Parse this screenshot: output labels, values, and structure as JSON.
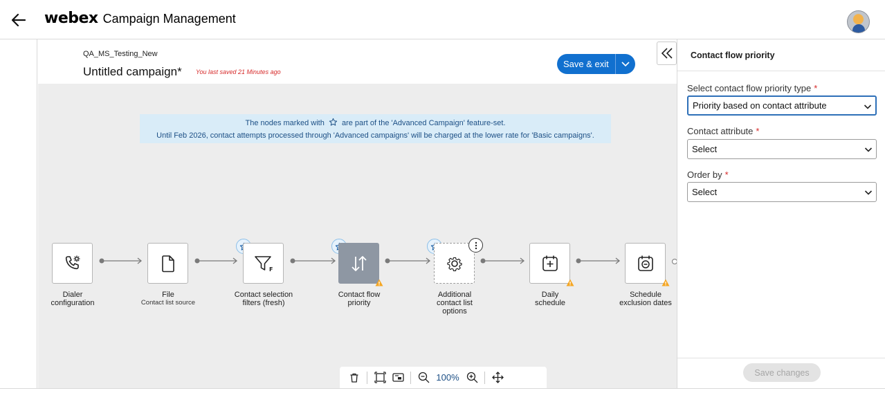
{
  "header": {
    "brand_logo": "webex",
    "app_title": "Campaign Management"
  },
  "campaign": {
    "subtitle": "QA_MS_Testing_New",
    "title": "Untitled campaign*",
    "saved_note": "You last saved 21 Minutes ago",
    "save_exit_label": "Save & exit"
  },
  "banner": {
    "line1_before": "The nodes marked with",
    "line1_after": "are part of the 'Advanced Campaign' feature-set.",
    "line2": "Until Feb 2026, contact attempts processed through 'Advanced campaigns' will be charged at the lower rate for 'Basic campaigns'."
  },
  "nodes": [
    {
      "label": "Dialer\nconfiguration",
      "sublabel": "",
      "icon": "phone-gear-icon",
      "advanced": false,
      "warning": false
    },
    {
      "label": "File",
      "sublabel": "Contact list source",
      "icon": "file-icon",
      "advanced": false,
      "warning": false
    },
    {
      "label": "Contact selection\nfilters (fresh)",
      "sublabel": "",
      "icon": "filter-icon",
      "advanced": true,
      "warning": false
    },
    {
      "label": "Contact flow\npriority",
      "sublabel": "",
      "icon": "sort-arrows-icon",
      "advanced": true,
      "warning": true
    },
    {
      "label": "Additional\ncontact list\noptions",
      "sublabel": "",
      "icon": "gear-icon",
      "advanced": true,
      "warning": false
    },
    {
      "label": "Daily\nschedule",
      "sublabel": "",
      "icon": "calendar-plus-icon",
      "advanced": false,
      "warning": true
    },
    {
      "label": "Schedule\nexclusion dates",
      "sublabel": "",
      "icon": "calendar-minus-icon",
      "advanced": false,
      "warning": true
    }
  ],
  "toolbar": {
    "zoom": "100%"
  },
  "panel": {
    "title": "Contact flow priority",
    "fields": [
      {
        "label": "Select contact flow priority type",
        "value": "Priority based on contact attribute"
      },
      {
        "label": "Contact attribute",
        "value": "Select"
      },
      {
        "label": "Order by",
        "value": "Select"
      }
    ],
    "required_mark": "*",
    "save_changes_label": "Save changes"
  },
  "colors": {
    "accent": "#1170cf",
    "required": "#d62a2a",
    "warning": "#f5a623",
    "active_node": "#8e97a3"
  }
}
